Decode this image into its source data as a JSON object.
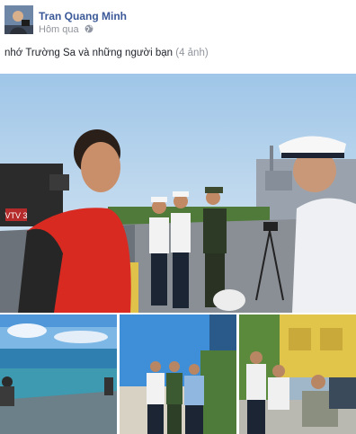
{
  "post": {
    "author_name": "Tran Quang Minh",
    "timestamp": "Hôm qua",
    "privacy_icon": "globe-icon",
    "caption_text": "nhớ Trường Sa và những người bạn",
    "photo_count": "(4 ảnh)"
  },
  "photos": {
    "main_badge": "VTV 3"
  },
  "colors": {
    "link": "#3b5998",
    "meta": "#90949c",
    "text": "#1d2129"
  }
}
